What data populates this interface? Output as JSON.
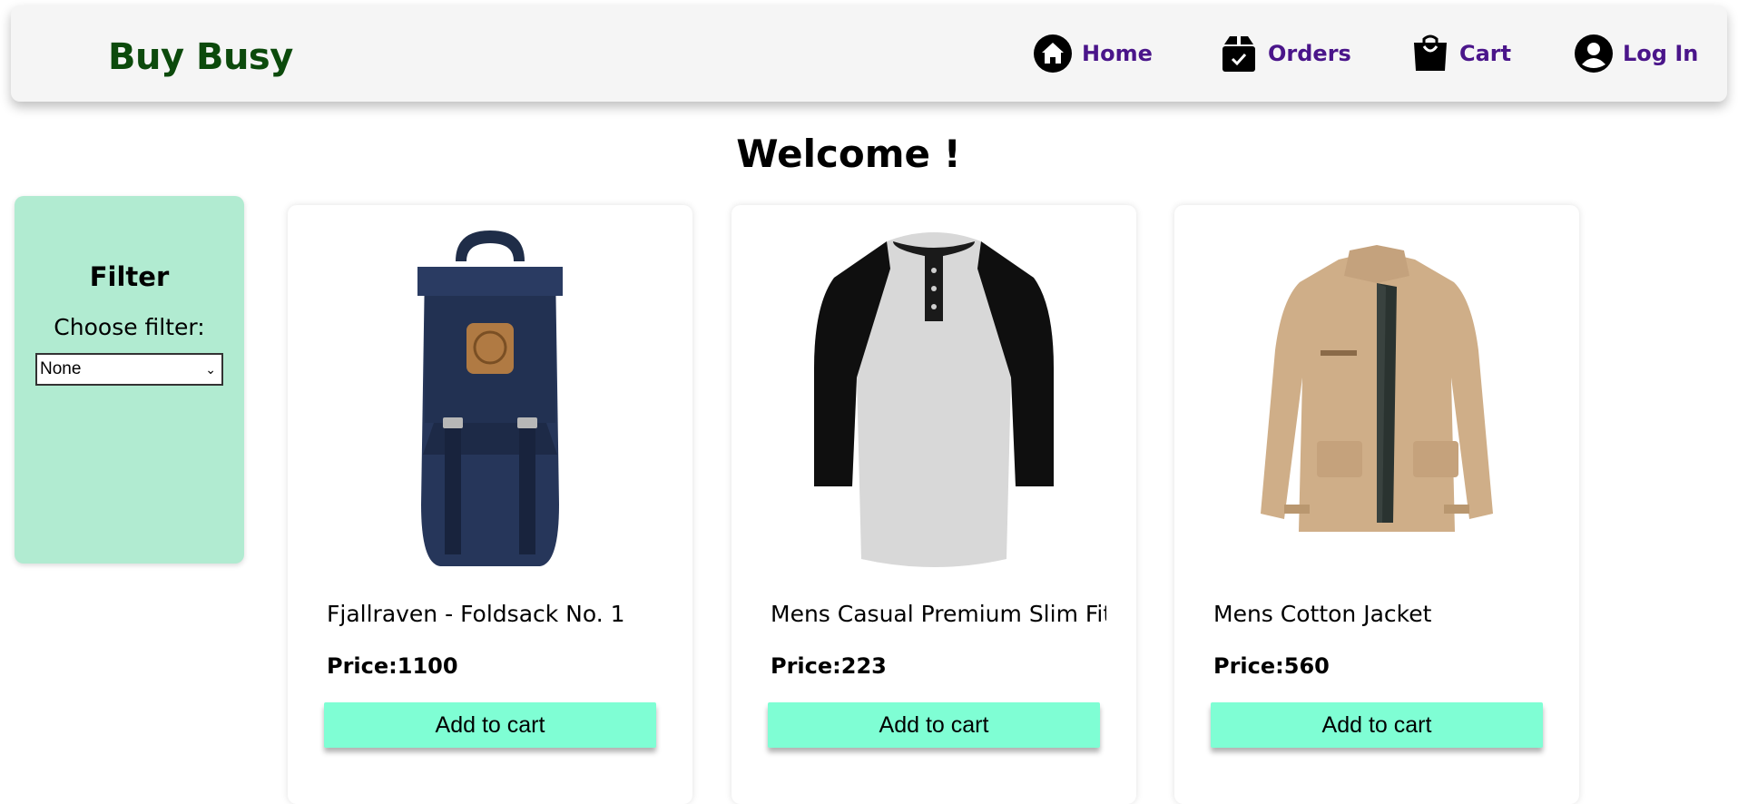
{
  "navbar": {
    "brand": "Buy Busy",
    "items": [
      {
        "label": "Home",
        "icon": "home-icon"
      },
      {
        "label": "Orders",
        "icon": "box-check-icon"
      },
      {
        "label": "Cart",
        "icon": "shopping-bag-icon"
      },
      {
        "label": "Log In",
        "icon": "user-circle-icon"
      }
    ],
    "link_color": "#4a158a",
    "brand_color": "#0c4a0c"
  },
  "welcome": "Welcome !",
  "filter": {
    "title": "Filter",
    "label": "Choose filter:",
    "selected": "None",
    "panel_color": "#b1ebd1"
  },
  "products": [
    {
      "title": "Fjallraven - Foldsack No. 1",
      "price": "Price:1100",
      "button": "Add to cart",
      "image": "backpack"
    },
    {
      "title": "Mens Casual Premium Slim Fit T-",
      "price": "Price:223",
      "button": "Add to cart",
      "image": "raglan-tshirt"
    },
    {
      "title": "Mens Cotton Jacket",
      "price": "Price:560",
      "button": "Add to cart",
      "image": "cotton-jacket"
    }
  ],
  "button_color": "#7ffed4"
}
